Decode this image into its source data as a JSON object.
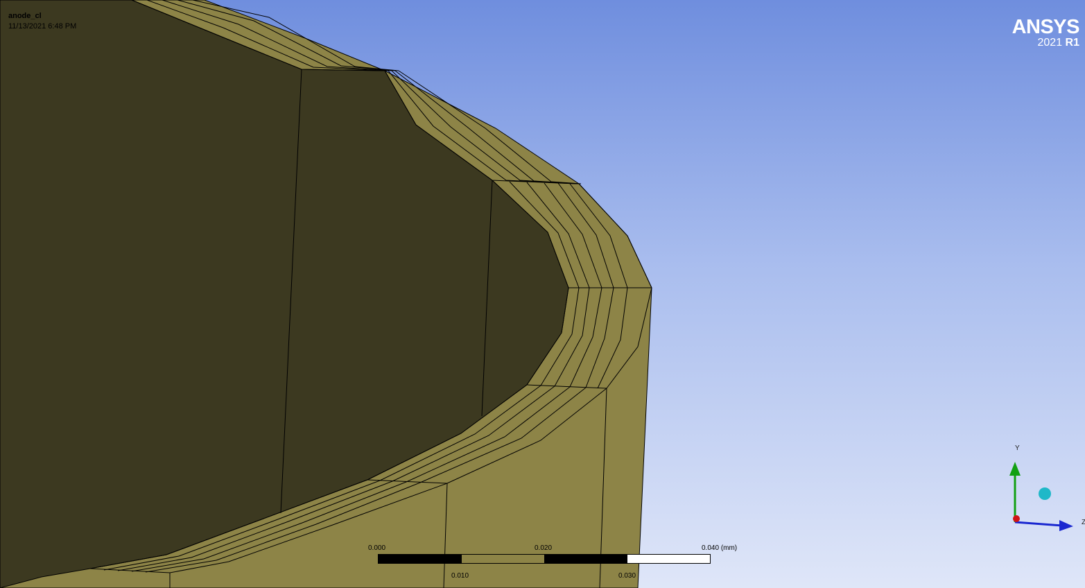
{
  "window": {
    "model_name": "anode_cl",
    "timestamp": "11/13/2021 6:48 PM"
  },
  "brand": {
    "name": "ANSYS",
    "version_year": "2021",
    "version_release": "R1"
  },
  "scale_bar": {
    "unit": "(mm)",
    "top_labels": [
      "0.000",
      "0.020",
      "0.040"
    ],
    "bottom_labels": [
      "0.010",
      "0.030"
    ]
  },
  "triad": {
    "y_label": "Y",
    "z_label": "Z"
  },
  "colors": {
    "face_dark": "#3c3920",
    "face_light": "#8d8447",
    "triad_y": "#12a012",
    "triad_z": "#1a28d0",
    "triad_x": "#d01414",
    "iso_ball": "#1fb8c8"
  }
}
